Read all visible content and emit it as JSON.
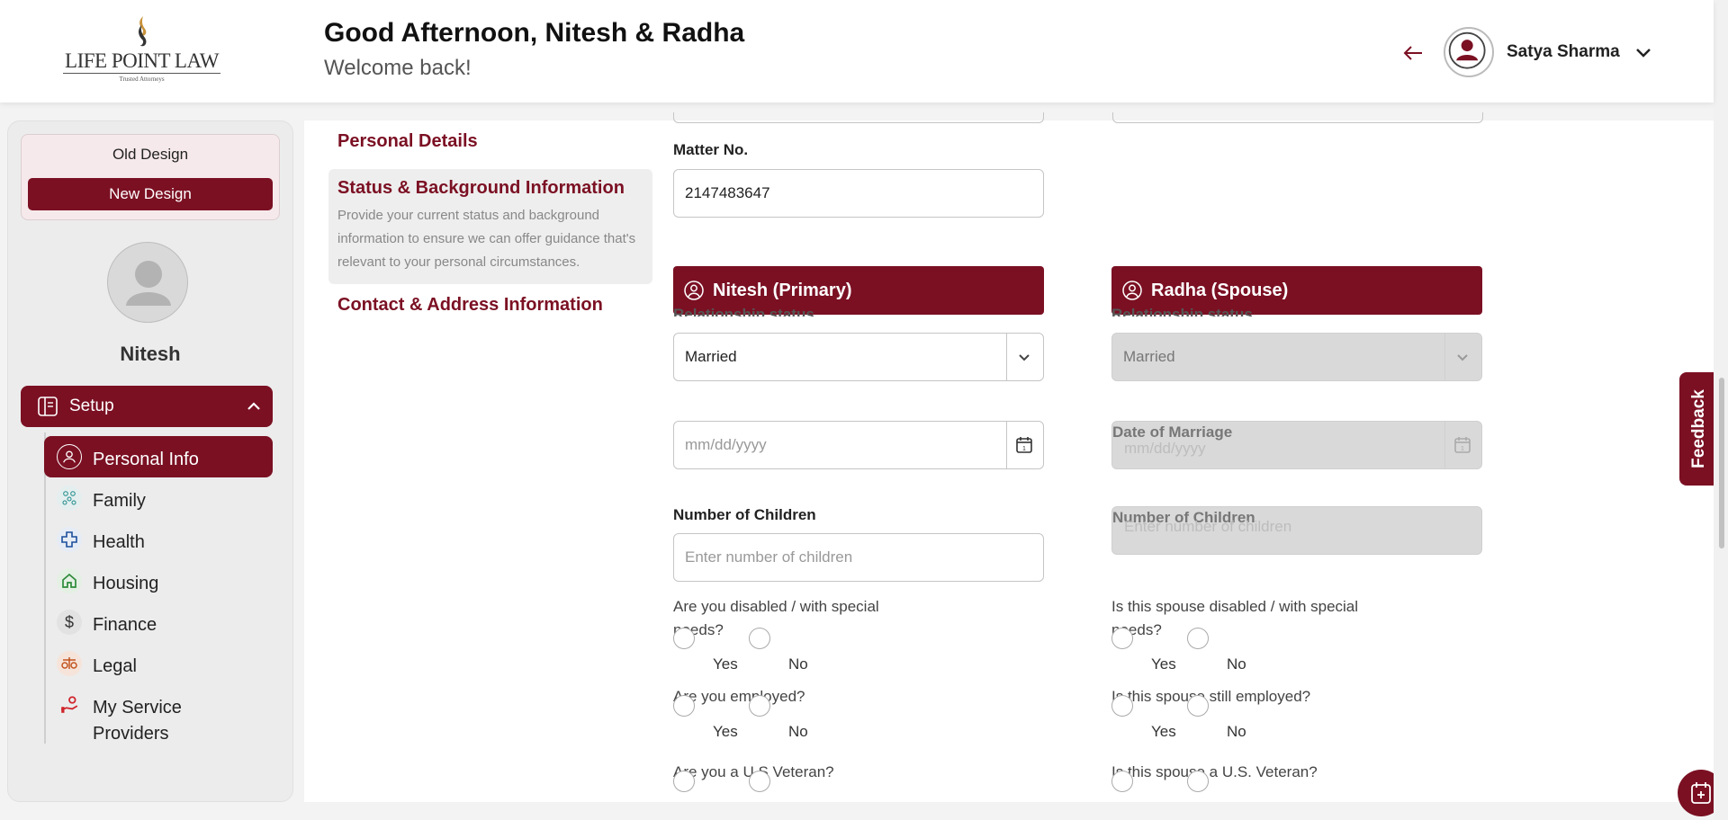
{
  "brand": {
    "name": "LIFE POINT LAW",
    "tagline": "Trusted Attorneys"
  },
  "header": {
    "greeting": "Good Afternoon, Nitesh & Radha",
    "subtitle": "Welcome back!",
    "user_name": "Satya Sharma"
  },
  "sidebar": {
    "old_design": "Old Design",
    "new_design": "New Design",
    "profile_name": "Nitesh",
    "setup_label": "Setup",
    "items": [
      {
        "label": "Personal Info",
        "icon": "user-circle-icon",
        "active": true
      },
      {
        "label": "Family",
        "icon": "family-icon",
        "active": false
      },
      {
        "label": "Health",
        "icon": "health-cross-icon",
        "active": false
      },
      {
        "label": "Housing",
        "icon": "house-icon",
        "active": false
      },
      {
        "label": "Finance",
        "icon": "dollar-icon",
        "active": false
      },
      {
        "label": "Legal",
        "icon": "scales-icon",
        "active": false
      },
      {
        "label": "My Service\nProviders",
        "icon": "service-provider-icon",
        "active": false
      }
    ]
  },
  "steps": {
    "personal_details": "Personal Details",
    "status_title": "Status & Background Information",
    "status_desc": "Provide your current status and background information to ensure we can offer guidance that's relevant to your personal circumstances.",
    "contact": "Contact & Address Information"
  },
  "form": {
    "matter_label": "Matter No.",
    "matter_value": "2147483647",
    "primary": {
      "header": "Nitesh (Primary)",
      "relationship_label": "Relationship status",
      "relationship_value": "Married",
      "date_placeholder": "mm/dd/yyyy",
      "children_label": "Number of Children",
      "children_placeholder": "Enter number of children",
      "disabled_q": "Are you disabled / with special needs?",
      "employed_q": "Are you employed?",
      "veteran_q": "Are you a U.S Veteran?"
    },
    "spouse": {
      "header": "Radha (Spouse)",
      "relationship_label": "Relationship status",
      "relationship_value": "Married",
      "date_label": "Date of Marriage",
      "date_placeholder": "mm/dd/yyyy",
      "children_label": "Number of Children",
      "children_placeholder": "Enter number of children",
      "disabled_q": "Is this spouse disabled / with special needs?",
      "employed_q": "Is this spouse still employed?",
      "veteran_q": "Is this spouse a U.S. Veteran?"
    },
    "yes": "Yes",
    "no": "No"
  },
  "feedback_label": "Feedback",
  "colors": {
    "brand": "#7b1023",
    "disabled": "#d9d9d9"
  }
}
